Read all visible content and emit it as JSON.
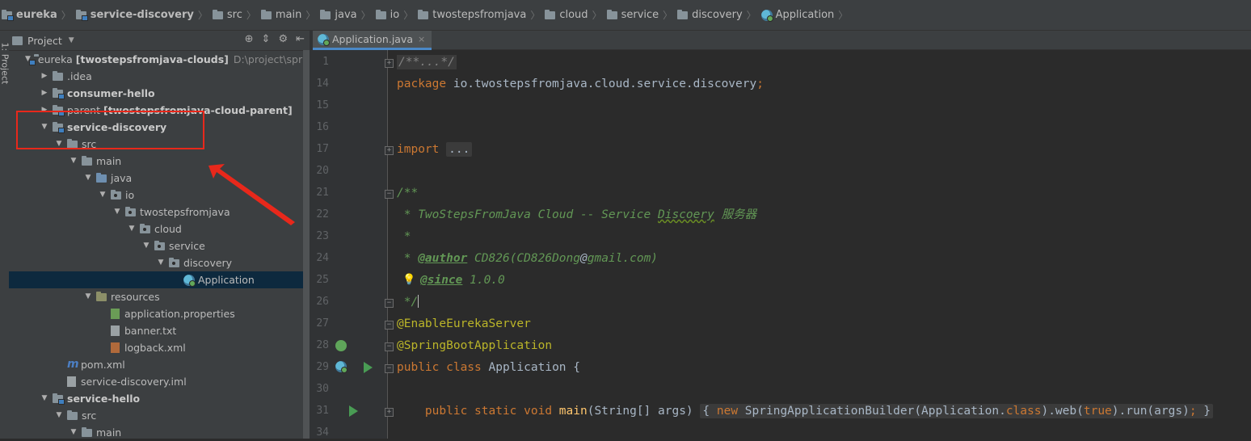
{
  "breadcrumb": [
    {
      "label": "eureka",
      "bold": true
    },
    {
      "label": "service-discovery",
      "bold": true
    },
    {
      "label": "src"
    },
    {
      "label": "main"
    },
    {
      "label": "java"
    },
    {
      "label": "io"
    },
    {
      "label": "twostepsfromjava"
    },
    {
      "label": "cloud"
    },
    {
      "label": "service"
    },
    {
      "label": "discovery"
    },
    {
      "label": "Application",
      "icon": "class-icon"
    }
  ],
  "side_strip": {
    "label": "1: Project"
  },
  "project_panel": {
    "title": "Project",
    "tree": [
      {
        "depth": 0,
        "arrow": "down",
        "icon": "module",
        "label": "eureka",
        "extra": "[twostepsfromjava-clouds]",
        "path": "D:\\project\\springClo"
      },
      {
        "depth": 1,
        "arrow": "right",
        "icon": "folder",
        "label": ".idea"
      },
      {
        "depth": 1,
        "arrow": "right",
        "icon": "module",
        "label": "consumer-hello",
        "bold": true
      },
      {
        "depth": 1,
        "arrow": "right",
        "icon": "module",
        "label": "parent",
        "extra": "[twostepsfromjava-cloud-parent]"
      },
      {
        "depth": 1,
        "arrow": "down",
        "icon": "module",
        "label": "service-discovery",
        "bold": true
      },
      {
        "depth": 2,
        "arrow": "down",
        "icon": "folder",
        "label": "src"
      },
      {
        "depth": 3,
        "arrow": "down",
        "icon": "folder",
        "label": "main"
      },
      {
        "depth": 4,
        "arrow": "down",
        "icon": "src",
        "label": "java"
      },
      {
        "depth": 5,
        "arrow": "down",
        "icon": "pkg",
        "label": "io"
      },
      {
        "depth": 6,
        "arrow": "down",
        "icon": "pkg",
        "label": "twostepsfromjava"
      },
      {
        "depth": 7,
        "arrow": "down",
        "icon": "pkg",
        "label": "cloud"
      },
      {
        "depth": 8,
        "arrow": "down",
        "icon": "pkg",
        "label": "service"
      },
      {
        "depth": 9,
        "arrow": "down",
        "icon": "pkg",
        "label": "discovery"
      },
      {
        "depth": 10,
        "arrow": "none",
        "icon": "class",
        "label": "Application",
        "selected": true
      },
      {
        "depth": 4,
        "arrow": "down",
        "icon": "res",
        "label": "resources"
      },
      {
        "depth": 5,
        "arrow": "none",
        "icon": "props",
        "label": "application.properties"
      },
      {
        "depth": 5,
        "arrow": "none",
        "icon": "txt",
        "label": "banner.txt"
      },
      {
        "depth": 5,
        "arrow": "none",
        "icon": "xml",
        "label": "logback.xml"
      },
      {
        "depth": 2,
        "arrow": "none",
        "icon": "maven",
        "label": "pom.xml"
      },
      {
        "depth": 2,
        "arrow": "none",
        "icon": "iml",
        "label": "service-discovery.iml"
      },
      {
        "depth": 1,
        "arrow": "down",
        "icon": "module",
        "label": "service-hello",
        "bold": true
      },
      {
        "depth": 2,
        "arrow": "down",
        "icon": "folder",
        "label": "src"
      },
      {
        "depth": 3,
        "arrow": "down",
        "icon": "folder",
        "label": "main"
      }
    ]
  },
  "editor": {
    "tab_label": "Application.java",
    "tab_close": "×",
    "line_numbers": [
      "1",
      "14",
      "15",
      "16",
      "17",
      "20",
      "21",
      "22",
      "23",
      "24",
      "25",
      "26",
      "27",
      "28",
      "29",
      "30",
      "31",
      "34"
    ],
    "code": {
      "l1": "/**...*/",
      "l14_kw": "package",
      "l14_rest": " io.twostepsfromjava.cloud.service.discovery",
      "l14_semi": ";",
      "l17_kw": "import",
      "l17_fold": "...",
      "l21": "/**",
      "l22_a": " * TwoStepsFromJava Cloud -- Service ",
      "l22_typo": "Discoery",
      "l22_b": " 服务器",
      "l23": " *",
      "l24_star": " * ",
      "l24_tag": "@author",
      "l24_rest": " CD826(CD826Dong",
      "l24_at": "@",
      "l24_rest2": "gmail.com)",
      "l25_tag": "@since",
      "l25_rest": " 1.0.0",
      "l26": " */",
      "l27": "@EnableEurekaServer",
      "l28": "@SpringBootApplication",
      "l29_kw": "public class",
      "l29_rest": " Application {",
      "l31_kw": "public static void",
      "l31_fn": "main",
      "l31_args": "(String[] args) ",
      "l31_fold_open": "{ ",
      "l31_new": "new",
      "l31_body": " SpringApplicationBuilder(Application.",
      "l31_class": "class",
      "l31_body2": ").web(",
      "l31_true": "true",
      "l31_body3": ").run(args)",
      "l31_semi": ";",
      "l31_close": " }"
    }
  },
  "colors": {
    "keyword": "#cc7832",
    "annotation": "#bbb529",
    "doc_comment": "#629755",
    "highlight_box": "#e8281b"
  }
}
